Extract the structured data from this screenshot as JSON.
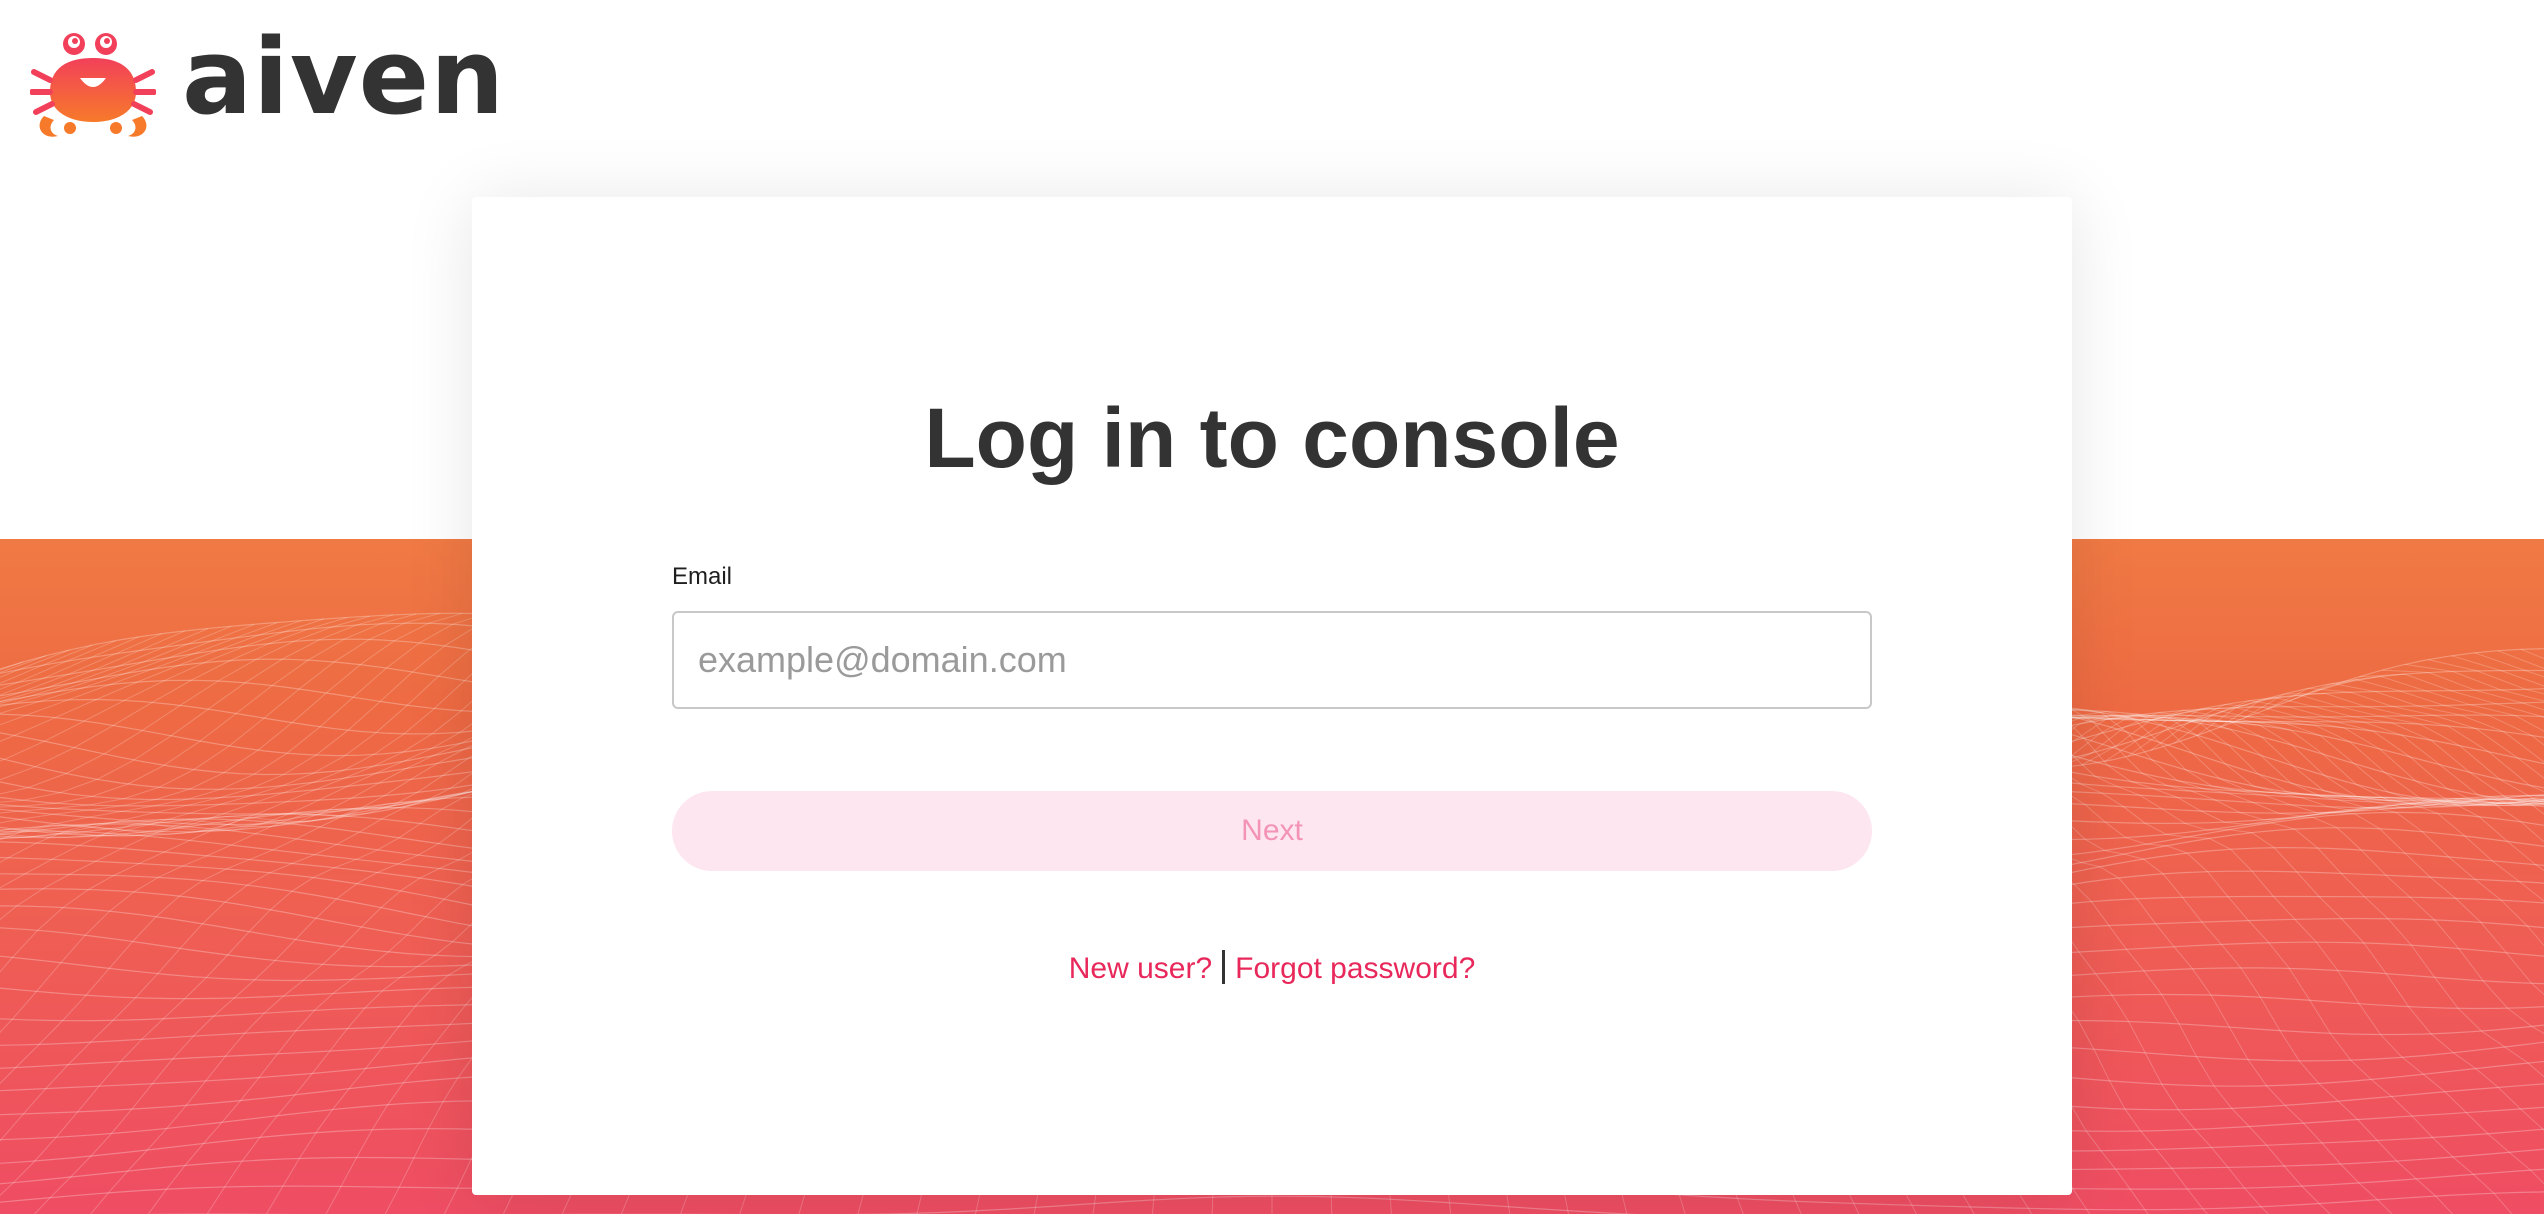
{
  "brand": {
    "name": "aiven",
    "logo_icon": "crab-logo-icon"
  },
  "login": {
    "title": "Log in to console",
    "email_label": "Email",
    "email_placeholder": "example@domain.com",
    "email_value": "",
    "next_label": "Next",
    "next_enabled": false,
    "new_user_link": "New user?",
    "forgot_password_link": "Forgot password?"
  },
  "colors": {
    "accent": "#e8285a",
    "button_disabled_bg": "#fde6f0",
    "button_disabled_text": "#f393b5",
    "text_dark": "#333333",
    "background_gradient_top": "#f07a44",
    "background_gradient_bottom": "#ef4d63"
  }
}
